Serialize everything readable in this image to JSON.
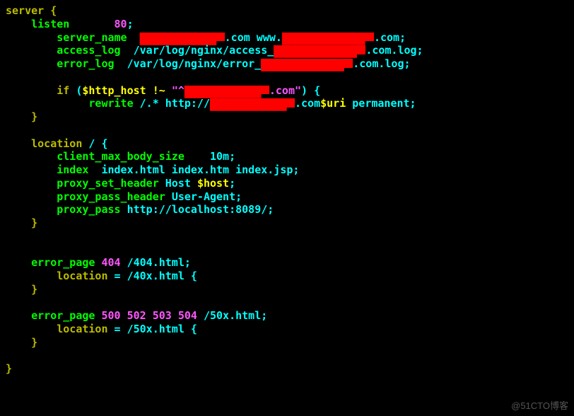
{
  "watermark": "@51CTO博客",
  "code": {
    "l1_server": "server {",
    "l2_listen": "listen",
    "l2_port": "80",
    "l3_servername": "server_name",
    "l3_suffix1": ".com www.",
    "l3_suffix2": ".com;",
    "l4_access": "access_log",
    "l4_path": "/var/log/nginx/access_",
    "l4_suffix": ".com.log;",
    "l5_error": "error_log",
    "l5_path": "/var/log/nginx/error_",
    "l5_suffix": ".com.log;",
    "l7_if": "if",
    "l7_open": "(",
    "l7_var": "$http_host",
    "l7_op": "!~",
    "l7_strq": "\"^",
    "l7_strmid": ".com",
    "l7_strend": "\"",
    "l7_close": ") {",
    "l8_rewrite": "rewrite",
    "l8_regex": "/.* http://",
    "l8_mid": ".com",
    "l8_var": "$uri",
    "l8_perm": " permanent;",
    "l11_location": "location",
    "l11_arg": "/ {",
    "l12_cmbs": "client_max_body_size",
    "l12_val": "10m",
    "l13_index": "index",
    "l13_val": "index.html index.htm index.jsp;",
    "l14_psh": "proxy_set_header",
    "l14_host": "Host",
    "l14_var": "$host",
    "l15_pph": "proxy_pass_header",
    "l15_val": "User-Agent;",
    "l16_pp": "proxy_pass",
    "l16_url": "http://localhost:8089/;",
    "l19_ep": "error_page",
    "l19_codes": "404",
    "l19_path": "/404.html;",
    "l20_loc": "location",
    "l20_eq": "=",
    "l20_path": "/40x.html {",
    "l23_ep": "error_page",
    "l23_codes": "500 502 503 504",
    "l23_path": "/50x.html;",
    "l24_loc": "location",
    "l24_eq": "=",
    "l24_path": "/50x.html {"
  }
}
